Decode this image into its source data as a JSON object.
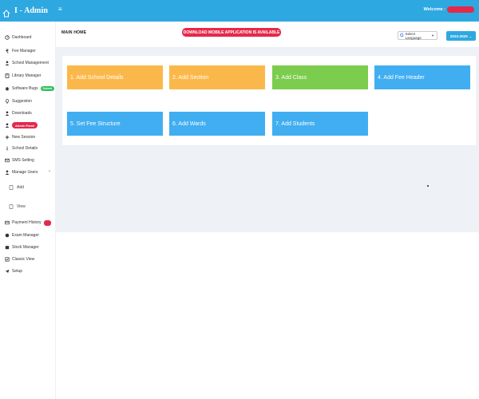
{
  "app": {
    "title": "I - Admin",
    "toggle": "≡"
  },
  "header": {
    "welcome": "Welcome :"
  },
  "sidebar": {
    "items": [
      {
        "label": "Dashboard",
        "icon": "gauge-icon"
      },
      {
        "label": "Fee Manager",
        "icon": "rupee-icon"
      },
      {
        "label": "School Management",
        "icon": "user-icon"
      },
      {
        "label": "Library Manager",
        "icon": "book-icon"
      },
      {
        "label": "Software Bugs",
        "icon": "bug-icon",
        "badge": "Solved"
      },
      {
        "label": "Suggestion",
        "icon": "lightbulb-icon"
      },
      {
        "label": "Downloads",
        "icon": "user-icon"
      },
      {
        "label": "Admin Panel",
        "icon": "user-icon"
      },
      {
        "label": "New Session",
        "icon": "plus-icon"
      },
      {
        "label": "School Details",
        "icon": "info-icon"
      },
      {
        "label": "SMS Setting",
        "icon": "envelope-icon"
      },
      {
        "label": "Manage Users",
        "icon": "user-icon"
      },
      {
        "label": "Add",
        "icon": "document-icon"
      },
      {
        "label": "View",
        "icon": "document-icon"
      },
      {
        "label": "Payment History",
        "icon": "card-icon",
        "badge": ""
      },
      {
        "label": "Exam Manager",
        "icon": "globe-icon"
      },
      {
        "label": "Stock Manager",
        "icon": "box-icon"
      },
      {
        "label": "Classic View",
        "icon": "check-square-icon"
      },
      {
        "label": "Setup",
        "icon": "send-icon"
      }
    ]
  },
  "main": {
    "breadcrumb": "MAIN HOME",
    "download_banner": "DOWNLOAD MOBILE APPLICATION IS AVAILABLE",
    "language": {
      "logo": "G",
      "label": "Select Language",
      "arrow": "▼"
    },
    "session_year": "2024-2025",
    "tiles": [
      {
        "label": "1. Add School Details",
        "color": "#fbb84a"
      },
      {
        "label": "2. Add Section",
        "color": "#fbb84a"
      },
      {
        "label": "3. Add Class",
        "color": "#7ccc4d"
      },
      {
        "label": "4. Add Fee Header",
        "color": "#41aef1"
      },
      {
        "label": "5. Set Fee Structure",
        "color": "#41aef1"
      },
      {
        "label": "6. Add Wards",
        "color": "#41aef1"
      },
      {
        "label": "7. Add Students",
        "color": "#41aef1"
      }
    ]
  },
  "colors": {
    "topbar": "#2ea8e1",
    "badge_red": "#e5294b",
    "badge_green": "#2fbf5b",
    "content_bg": "#eef1f6"
  }
}
